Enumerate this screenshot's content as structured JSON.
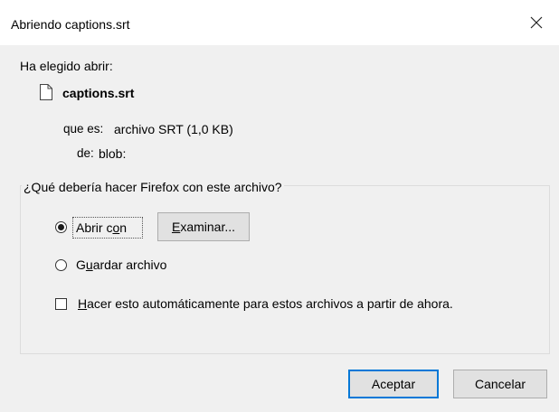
{
  "window": {
    "title": "Abriendo captions.srt",
    "close_icon": "close-icon"
  },
  "intro": "Ha elegido abrir:",
  "file": {
    "icon": "document-icon",
    "name": "captions.srt",
    "type_label": "que es:",
    "type_value": "archivo SRT (1,0 KB)",
    "from_label": "de:",
    "from_value": "blob:"
  },
  "action_group": {
    "legend": "¿Qué debería hacer Firefox con este archivo?",
    "open_with": {
      "pre": "Abrir c",
      "accel": "o",
      "post": "n",
      "selected": true
    },
    "browse": {
      "accel": "E",
      "rest": "xaminar..."
    },
    "save_file": {
      "pre": "G",
      "accel": "u",
      "post": "ardar archivo",
      "selected": false
    },
    "auto": {
      "accel": "H",
      "rest": "acer esto automáticamente para estos archivos a partir de ahora.",
      "checked": false
    }
  },
  "buttons": {
    "accept": "Aceptar",
    "cancel": "Cancelar"
  },
  "colors": {
    "default_button_border": "#0078d7",
    "dialog_background": "#f0f0f0"
  }
}
